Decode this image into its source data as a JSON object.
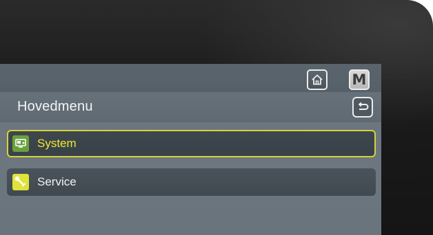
{
  "window": {
    "title": "Hovedmenu"
  },
  "topbar": {
    "home_icon": "home-icon",
    "mode_button_label": "M"
  },
  "header": {
    "back_icon": "back-arrow-icon"
  },
  "menu": {
    "items": [
      {
        "label": "System",
        "icon": "system-icon",
        "selected": true
      },
      {
        "label": "Service",
        "icon": "wrench-icon",
        "selected": false
      }
    ]
  },
  "colors": {
    "selection_outline": "#d8d23a",
    "selected_text": "#eeea2c",
    "system_icon_bg": "#6aa13b",
    "service_icon_bg": "#dfe33a",
    "screen_bg": "#6e7880"
  }
}
